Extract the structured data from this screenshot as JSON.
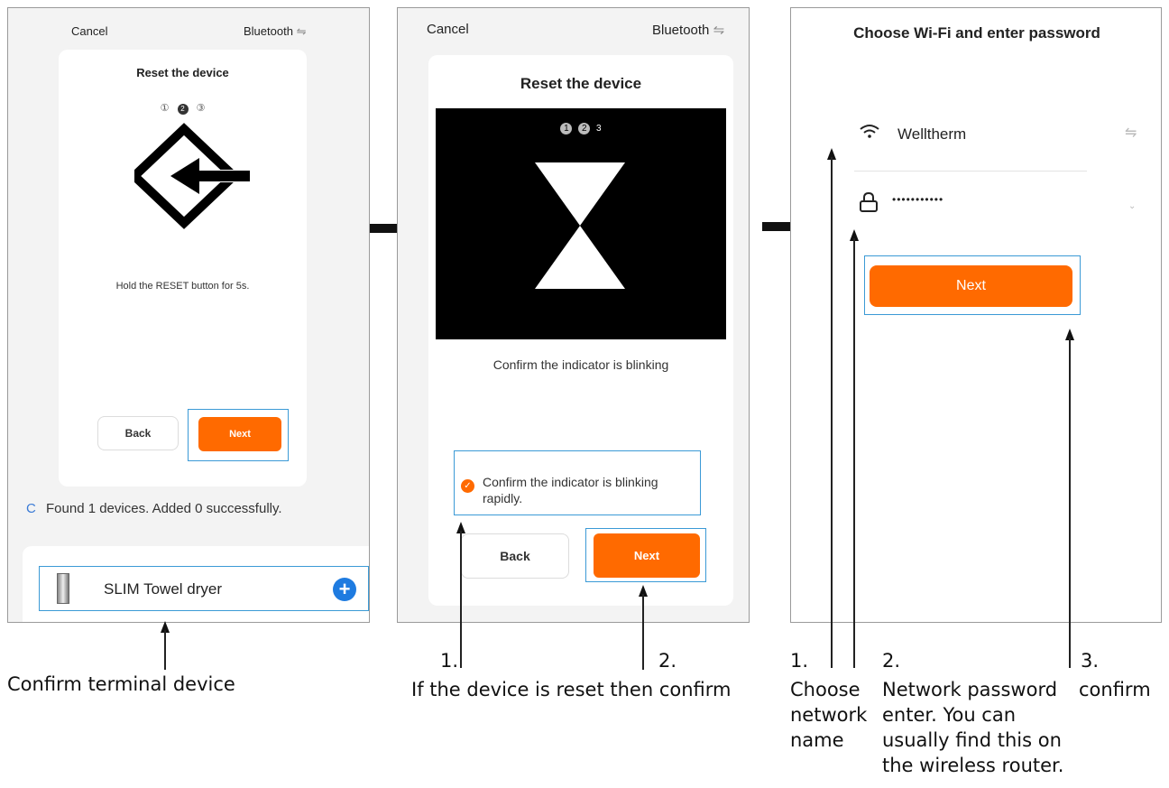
{
  "panel1": {
    "cancel": "Cancel",
    "bluetooth": "Bluetooth",
    "title": "Reset the device",
    "steps": [
      "①",
      "2",
      "③"
    ],
    "instruction": "Hold the RESET button for 5s.",
    "back": "Back",
    "next": "Next",
    "found": "Found 1 devices. Added 0 successfully.",
    "device_name": "SLIM Towel dryer"
  },
  "panel2": {
    "cancel": "Cancel",
    "bluetooth": "Bluetooth",
    "title": "Reset the device",
    "steps": [
      "1",
      "2",
      "3"
    ],
    "caption": "Confirm the indicator is blinking",
    "confirm_line1": "Confirm the indicator is blinking",
    "confirm_line2": "rapidly.",
    "back": "Back",
    "next": "Next"
  },
  "panel3": {
    "title": "Choose Wi-Fi and enter password",
    "network": "Welltherm",
    "password": "•••••••••••",
    "next": "Next"
  },
  "annotations": {
    "terminal": "Confirm terminal device",
    "p2_num1": "1.",
    "p2_num2": "2.",
    "p2_text": "If the device is reset then confirm",
    "p3_num1": "1.",
    "p3_num2": "2.",
    "p3_num3": "3.",
    "p3_text1": [
      "Choose",
      "network",
      "name"
    ],
    "p3_text2": [
      "Network password",
      "enter. You can",
      "usually find this on",
      "the wireless router."
    ],
    "p3_text3": "confirm"
  },
  "colors": {
    "accent": "#ff6a00",
    "highlight": "#3b9ad6",
    "plus": "#1e7be0"
  }
}
